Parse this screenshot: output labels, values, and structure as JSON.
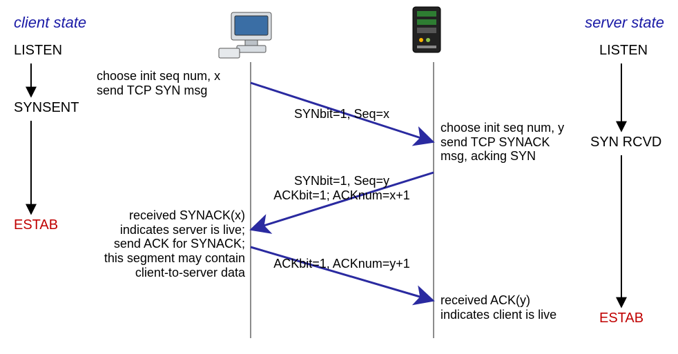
{
  "headers": {
    "client": "client state",
    "server": "server state"
  },
  "client_states": {
    "s0": "LISTEN",
    "s1": "SYNSENT",
    "s2": "ESTAB"
  },
  "server_states": {
    "s0": "LISTEN",
    "s1": "SYN RCVD",
    "s2": "ESTAB"
  },
  "client_notes": {
    "n1a": "choose init seq num, x",
    "n1b": "send TCP SYN msg",
    "n2a": "received SYNACK(x)",
    "n2b": "indicates server is live;",
    "n2c": "send ACK for SYNACK;",
    "n2d": "this segment may contain",
    "n2e": "client-to-server data"
  },
  "server_notes": {
    "n1a": "choose init seq num, y",
    "n1b": "send TCP SYNACK",
    "n1c": "msg, acking SYN",
    "n2a": "received ACK(y)",
    "n2b": "indicates client is live"
  },
  "messages": {
    "m1": "SYNbit=1, Seq=x",
    "m2a": "SYNbit=1, Seq=y",
    "m2b": "ACKbit=1; ACKnum=x+1",
    "m3": "ACKbit=1, ACKnum=y+1"
  }
}
